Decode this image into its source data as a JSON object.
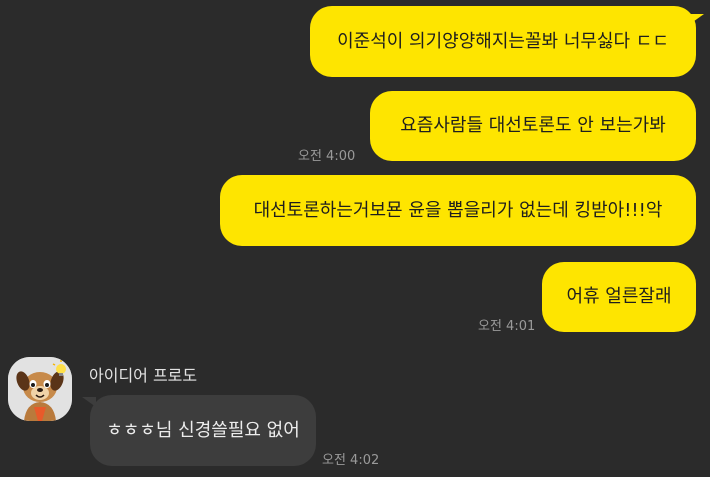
{
  "messages": {
    "m1": {
      "text": "이준석이 의기양양해지는꼴봐 너무싫다 ㄷㄷ"
    },
    "m2": {
      "text": "요즘사람들 대선토론도 안 보는가봐",
      "time": "오전 4:00"
    },
    "m3": {
      "text": "대선토론하는거보묜 윤을 뽑을리가 없는데 킹받아!!!악"
    },
    "m4": {
      "text": "어휴 얼른잘래",
      "time": "오전 4:01"
    },
    "m5": {
      "sender": "아이디어 프로도",
      "text": "ㅎㅎㅎ님 신경쓸필요 없어",
      "time": "오전 4:02"
    }
  },
  "colors": {
    "background": "#2b2b2b",
    "my_bubble": "#fee500",
    "other_bubble": "#3d3d3d"
  },
  "icons": {
    "avatar": "frodo-dog-character-avatar"
  }
}
